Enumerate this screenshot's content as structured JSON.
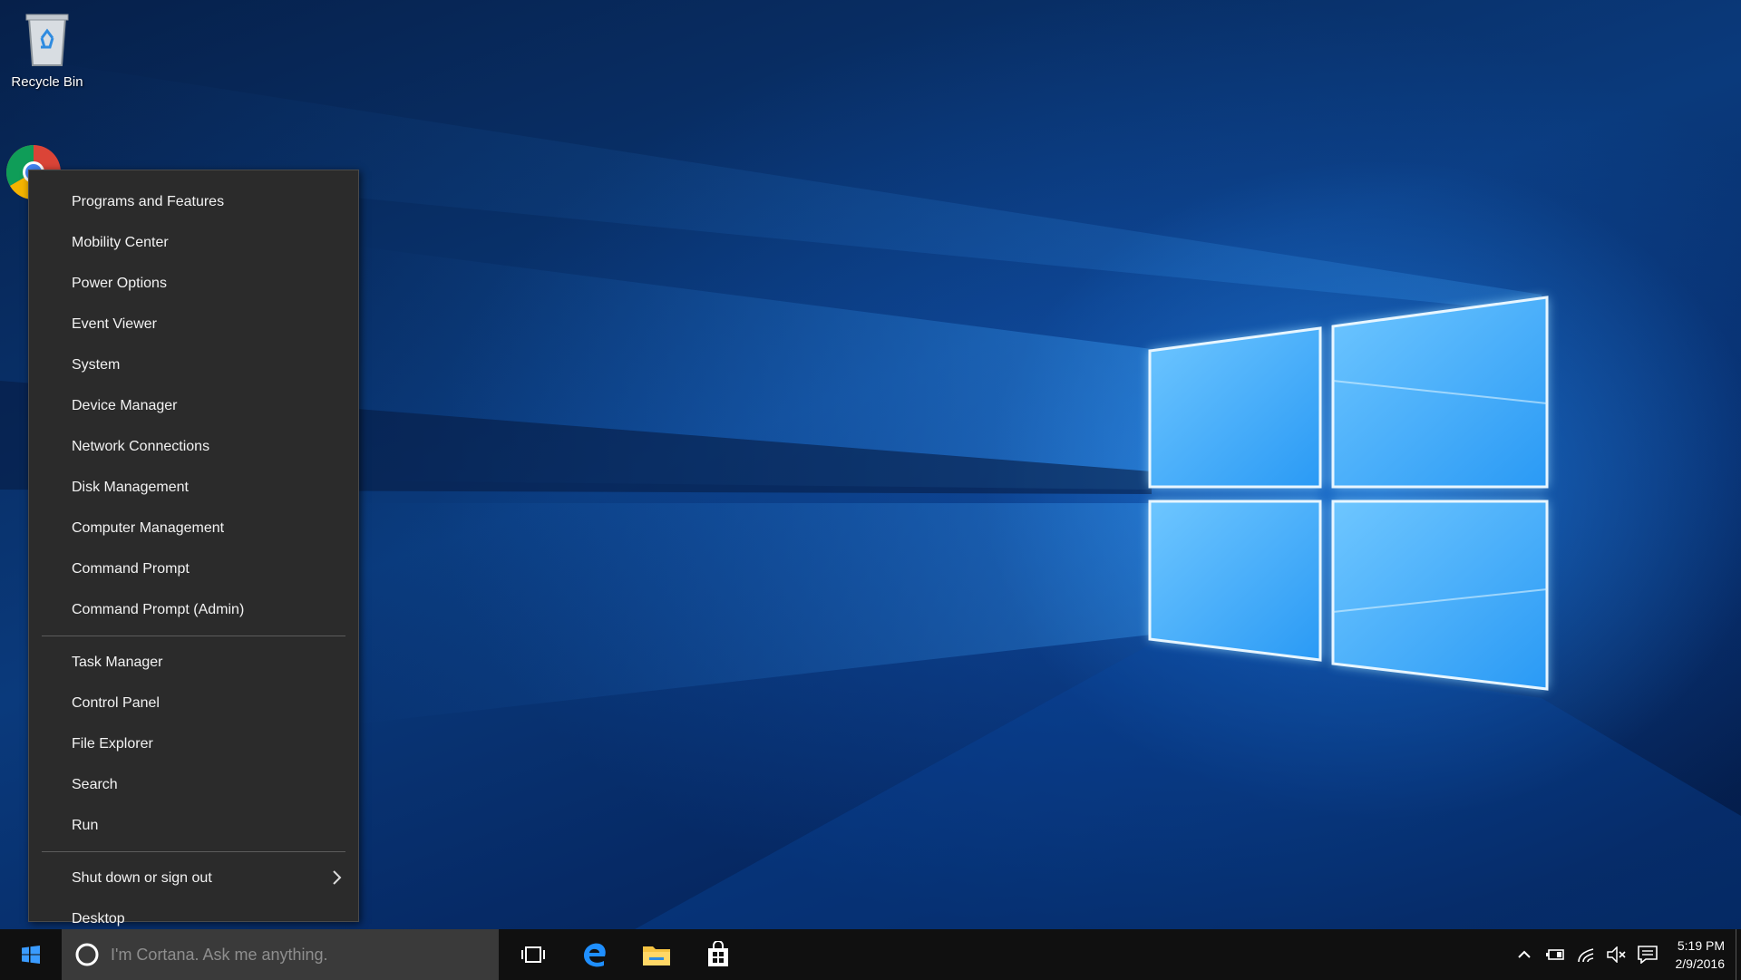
{
  "desktop": {
    "icons": [
      {
        "label": "Recycle Bin",
        "icon": "recycle-bin-icon"
      },
      {
        "label": "",
        "icon": "chrome-icon"
      },
      {
        "label": "",
        "icon": "app-shortcut-icon"
      }
    ]
  },
  "winx_menu": {
    "group1": [
      "Programs and Features",
      "Mobility Center",
      "Power Options",
      "Event Viewer",
      "System",
      "Device Manager",
      "Network Connections",
      "Disk Management",
      "Computer Management",
      "Command Prompt",
      "Command Prompt (Admin)"
    ],
    "group2": [
      "Task Manager",
      "Control Panel",
      "File Explorer",
      "Search",
      "Run"
    ],
    "group3": [
      {
        "label": "Shut down or sign out",
        "has_submenu": true
      },
      {
        "label": "Desktop",
        "has_submenu": false
      }
    ]
  },
  "taskbar": {
    "cortana_placeholder": "I'm Cortana. Ask me anything.",
    "pinned": [
      "task-view-icon",
      "edge-icon",
      "file-explorer-icon",
      "store-icon"
    ],
    "tray_icons": [
      "chevron-up-icon",
      "battery-icon",
      "network-icon",
      "volume-muted-icon",
      "action-center-icon"
    ],
    "clock": {
      "time": "5:19 PM",
      "date": "2/9/2016"
    }
  },
  "colors": {
    "menu_bg": "#2b2b2b",
    "taskbar_bg": "#101010",
    "accent": "#1e90ff"
  }
}
